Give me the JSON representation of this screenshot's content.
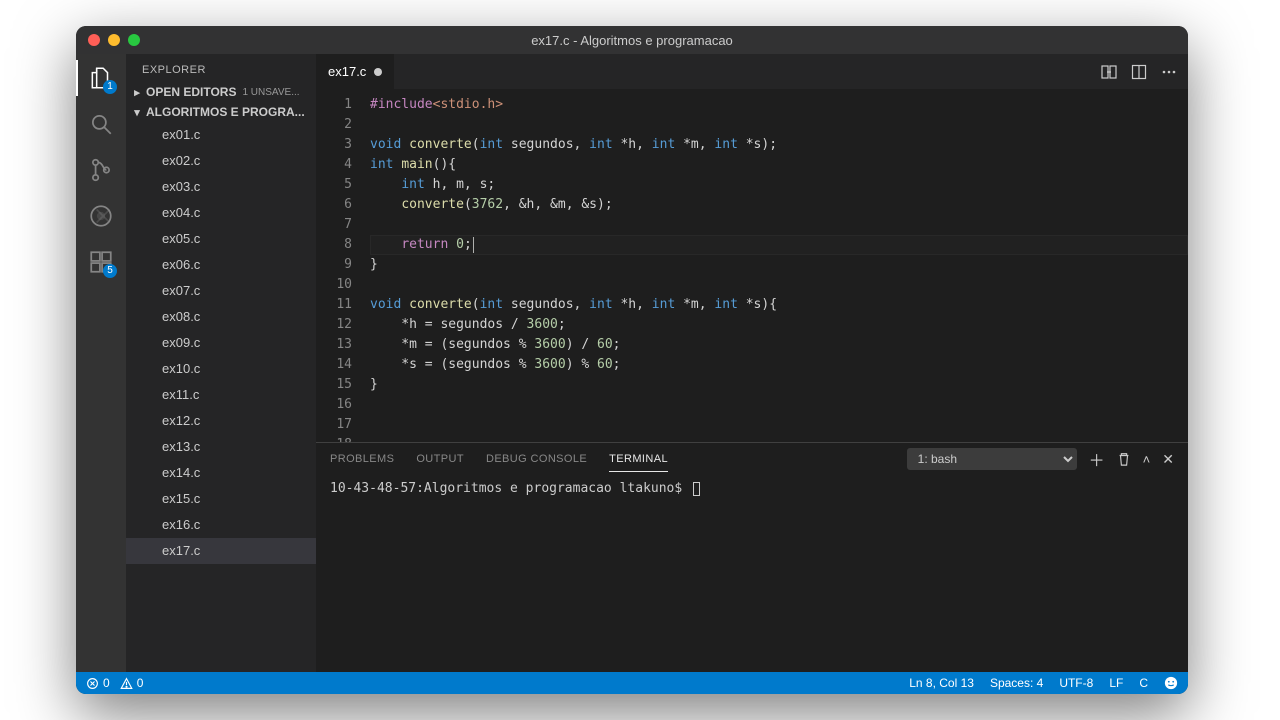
{
  "window": {
    "title": "ex17.c - Algoritmos e programacao"
  },
  "activity": {
    "badge_explorer": "1",
    "badge_ext": "5"
  },
  "sidebar": {
    "title": "EXPLORER",
    "open_editors_label": "OPEN EDITORS",
    "unsaved_label": "1 UNSAVE...",
    "folder_label": "ALGORITMOS E PROGRA...",
    "files": [
      "ex01.c",
      "ex02.c",
      "ex03.c",
      "ex04.c",
      "ex05.c",
      "ex06.c",
      "ex07.c",
      "ex08.c",
      "ex09.c",
      "ex10.c",
      "ex11.c",
      "ex12.c",
      "ex13.c",
      "ex14.c",
      "ex15.c",
      "ex16.c",
      "ex17.c"
    ],
    "selected": "ex17.c"
  },
  "tab": {
    "label": "ex17.c"
  },
  "code": {
    "line_count": 18,
    "highlight_line": 8,
    "tokens": [
      [
        [
          "#include",
          "tk-pre"
        ],
        [
          "<stdio.h>",
          "tk-inc"
        ]
      ],
      [],
      [
        [
          "void",
          "tk-kw"
        ],
        [
          " ",
          ""
        ],
        [
          "converte",
          "tk-fn"
        ],
        [
          "(",
          ""
        ],
        [
          "int",
          "tk-kw"
        ],
        [
          " segundos, ",
          ""
        ],
        [
          "int",
          "tk-kw"
        ],
        [
          " *h, ",
          ""
        ],
        [
          "int",
          "tk-kw"
        ],
        [
          " *m, ",
          ""
        ],
        [
          "int",
          "tk-kw"
        ],
        [
          " *s);",
          ""
        ]
      ],
      [
        [
          "int",
          "tk-kw"
        ],
        [
          " ",
          ""
        ],
        [
          "main",
          "tk-fn"
        ],
        [
          "(){",
          ""
        ]
      ],
      [
        [
          "    ",
          ""
        ],
        [
          "int",
          "tk-kw"
        ],
        [
          " h, m, s;",
          ""
        ]
      ],
      [
        [
          "    ",
          ""
        ],
        [
          "converte",
          "tk-fn"
        ],
        [
          "(",
          ""
        ],
        [
          "3762",
          "tk-num"
        ],
        [
          ", &h, &m, &s);",
          ""
        ]
      ],
      [],
      [
        [
          "    ",
          ""
        ],
        [
          "return",
          "tk-pre"
        ],
        [
          " ",
          ""
        ],
        [
          "0",
          "tk-num"
        ],
        [
          ";",
          ""
        ]
      ],
      [
        [
          "}",
          ""
        ]
      ],
      [],
      [
        [
          "void",
          "tk-kw"
        ],
        [
          " ",
          ""
        ],
        [
          "converte",
          "tk-fn"
        ],
        [
          "(",
          ""
        ],
        [
          "int",
          "tk-kw"
        ],
        [
          " segundos, ",
          ""
        ],
        [
          "int",
          "tk-kw"
        ],
        [
          " *h, ",
          ""
        ],
        [
          "int",
          "tk-kw"
        ],
        [
          " *m, ",
          ""
        ],
        [
          "int",
          "tk-kw"
        ],
        [
          " *s){",
          ""
        ]
      ],
      [
        [
          "    *h = segundos / ",
          ""
        ],
        [
          "3600",
          "tk-num"
        ],
        [
          ";",
          ""
        ]
      ],
      [
        [
          "    *m = (segundos % ",
          ""
        ],
        [
          "3600",
          "tk-num"
        ],
        [
          ") / ",
          ""
        ],
        [
          "60",
          "tk-num"
        ],
        [
          ";",
          ""
        ]
      ],
      [
        [
          "    *s = (segundos % ",
          ""
        ],
        [
          "3600",
          "tk-num"
        ],
        [
          ") % ",
          ""
        ],
        [
          "60",
          "tk-num"
        ],
        [
          ";",
          ""
        ]
      ],
      [
        [
          "}",
          ""
        ]
      ],
      [],
      [],
      []
    ]
  },
  "panel": {
    "tabs": {
      "problems": "PROBLEMS",
      "output": "OUTPUT",
      "debug": "DEBUG CONSOLE",
      "terminal": "TERMINAL"
    },
    "select_value": "1: bash",
    "prompt": "10-43-48-57:Algoritmos e programacao ltakuno$ "
  },
  "status": {
    "errors": "0",
    "warnings": "0",
    "lncol": "Ln 8, Col 13",
    "spaces": "Spaces: 4",
    "encoding": "UTF-8",
    "eol": "LF",
    "lang": "C"
  }
}
